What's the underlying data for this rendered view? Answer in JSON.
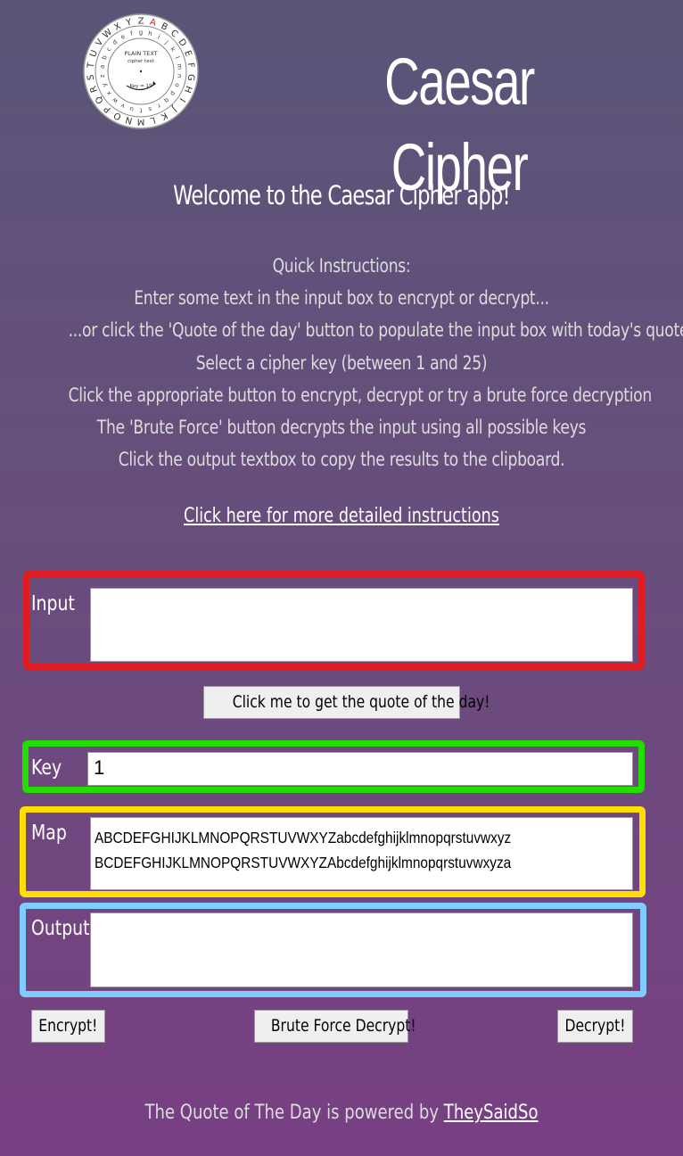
{
  "header": {
    "logo_icon": "cipher-wheel-icon",
    "title": "Caesar Cipher"
  },
  "welcome": "Welcome to the Caesar Cipher app!",
  "instructions": [
    "Quick Instructions:",
    "Enter some text in the input box to encrypt or decrypt...",
    "...or click the 'Quote of the day' button to populate the input box with today's quote",
    "Select a cipher key (between 1 and 25)",
    "Click the appropriate button to encrypt, decrypt or try a brute force decryption",
    "The 'Brute Force' button decrypts the input using all possible keys",
    "Click the output textbox to copy the results to the clipboard."
  ],
  "more_instructions_link": "Click here for more detailed instructions",
  "input": {
    "label": "Input",
    "value": ""
  },
  "quote_button": "Click me to get the quote of the day!",
  "key": {
    "label": "Key",
    "value": "1"
  },
  "map": {
    "label": "Map",
    "plain": "ABCDEFGHIJKLMNOPQRSTUVWXYZabcdefghijklmnopqrstuvwxyz",
    "cipher": "BCDEFGHIJKLMNOPQRSTUVWXYZAbcdefghijklmnopqrstuvwxyza"
  },
  "output": {
    "label": "Output",
    "value": ""
  },
  "buttons": {
    "encrypt": "Encrypt!",
    "brute": "Brute Force Decrypt!",
    "decrypt": "Decrypt!"
  },
  "footer": {
    "text": "The Quote of The Day is powered by ",
    "link": "TheySaidSo"
  },
  "colors": {
    "input_border": "#e11b22",
    "key_border": "#23dc00",
    "map_border": "#ffdf00",
    "output_border": "#80ccff"
  }
}
